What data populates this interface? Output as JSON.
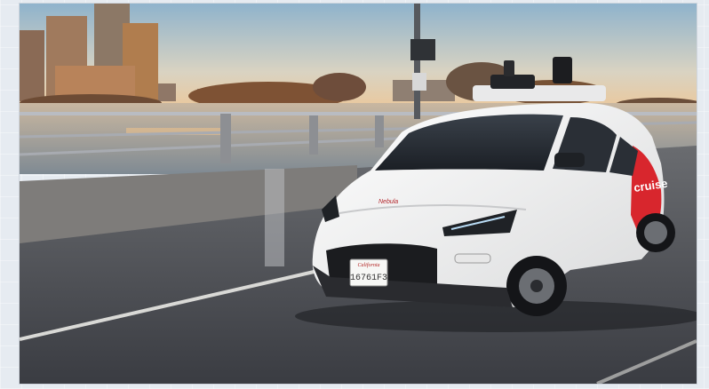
{
  "image": {
    "alt": "White and red self-driving car with roof sensors on a bridge at sunset",
    "vehicle": {
      "front_badge": "Nebula",
      "side_brand": "cruise",
      "plate": {
        "state": "California",
        "number": "16761F3"
      }
    },
    "colors": {
      "sky_top": "#9bb9cf",
      "sky_bottom": "#f3c793",
      "car_body": "#f6f6f4",
      "car_accent": "#e0282e",
      "road": "#4a4c52"
    }
  }
}
